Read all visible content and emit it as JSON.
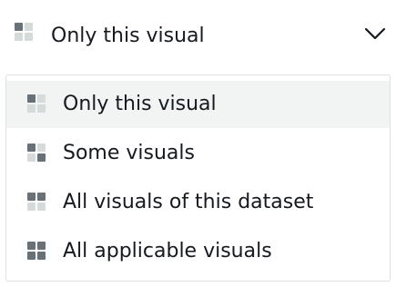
{
  "select": {
    "value": "Only this visual",
    "icon": "grid-one-filled-icon",
    "chevron_icon": "chevron-down-icon"
  },
  "options": [
    {
      "label": "Only this visual",
      "icon": "grid-one-filled-icon",
      "filled_cells": [
        0
      ],
      "selected": true
    },
    {
      "label": "Some visuals",
      "icon": "grid-two-filled-icon",
      "filled_cells": [
        0,
        3
      ],
      "selected": false
    },
    {
      "label": "All visuals of this dataset",
      "icon": "grid-top-filled-icon",
      "filled_cells": [
        0,
        1
      ],
      "selected": false
    },
    {
      "label": "All applicable visuals",
      "icon": "grid-all-filled-icon",
      "filled_cells": [
        0,
        1,
        2,
        3
      ],
      "selected": false
    }
  ],
  "colors": {
    "text": "#16191f",
    "icon_filled": "#687078",
    "icon_empty": "#d5dbdb",
    "selected_bg": "#f2f3f3",
    "border": "#dfe1e3"
  }
}
